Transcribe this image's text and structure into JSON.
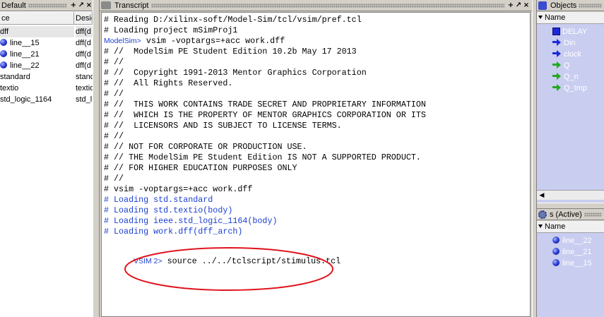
{
  "left_panel": {
    "title": "Default",
    "columns": [
      "ce",
      "Desig"
    ],
    "rows": [
      {
        "name": "dff",
        "design": "dff(d",
        "icon": "",
        "selected": true
      },
      {
        "name": "line__15",
        "design": "dff(d",
        "icon": "process-ball-icon",
        "selected": false
      },
      {
        "name": "line__21",
        "design": "dff(d",
        "icon": "process-ball-icon",
        "selected": false
      },
      {
        "name": "line__22",
        "design": "dff(d",
        "icon": "process-ball-icon",
        "selected": false
      },
      {
        "name": "standard",
        "design": "stand",
        "icon": "",
        "selected": false
      },
      {
        "name": "textio",
        "design": "textio",
        "icon": "",
        "selected": false
      },
      {
        "name": "std_logic_1164",
        "design": "std_l",
        "icon": "",
        "selected": false
      }
    ]
  },
  "transcript": {
    "title": "Transcript",
    "lines": [
      {
        "text": "# Reading D:/xilinx-soft/Model-Sim/tcl/vsim/pref.tcl",
        "style": "normal"
      },
      {
        "text": "# Loading project mSimProj1",
        "style": "normal"
      },
      {
        "prompt": "ModelSim>",
        "text": " vsim -voptargs=+acc work.dff",
        "style": "prompt"
      },
      {
        "text": "# //  ModelSim PE Student Edition 10.2b May 17 2013",
        "style": "normal"
      },
      {
        "text": "# //",
        "style": "normal"
      },
      {
        "text": "# //  Copyright 1991-2013 Mentor Graphics Corporation",
        "style": "normal"
      },
      {
        "text": "# //  All Rights Reserved.",
        "style": "normal"
      },
      {
        "text": "# //",
        "style": "normal"
      },
      {
        "text": "# //  THIS WORK CONTAINS TRADE SECRET AND PROPRIETARY INFORMATION",
        "style": "normal"
      },
      {
        "text": "# //  WHICH IS THE PROPERTY OF MENTOR GRAPHICS CORPORATION OR ITS",
        "style": "normal"
      },
      {
        "text": "# //  LICENSORS AND IS SUBJECT TO LICENSE TERMS.",
        "style": "normal"
      },
      {
        "text": "# //",
        "style": "normal"
      },
      {
        "text": "# // NOT FOR CORPORATE OR PRODUCTION USE.",
        "style": "normal"
      },
      {
        "text": "# // THE ModelSim PE Student Edition IS NOT A SUPPORTED PRODUCT.",
        "style": "normal"
      },
      {
        "text": "# // FOR HIGHER EDUCATION PURPOSES ONLY",
        "style": "normal"
      },
      {
        "text": "# //",
        "style": "normal"
      },
      {
        "text": "# vsim -voptargs=+acc work.dff",
        "style": "normal"
      },
      {
        "text": "# Loading std.standard",
        "style": "blue"
      },
      {
        "text": "# Loading std.textio(body)",
        "style": "blue"
      },
      {
        "text": "# Loading ieee.std_logic_1164(body)",
        "style": "blue"
      },
      {
        "text": "# Loading work.dff(dff_arch)",
        "style": "blue"
      }
    ],
    "command_prompt": "VSIM 2>",
    "command": " source ../../tclscript/stimulus.tcl",
    "annotation_color": "#e0141e"
  },
  "objects": {
    "title": "Objects",
    "column": "Name",
    "items": [
      {
        "name": "DELAY",
        "kind": "constant-icon"
      },
      {
        "name": "Din",
        "kind": "input-port-icon"
      },
      {
        "name": "clock",
        "kind": "input-port-icon"
      },
      {
        "name": "Q",
        "kind": "output-port-icon"
      },
      {
        "name": "Q_n",
        "kind": "output-port-icon"
      },
      {
        "name": "Q_tmp",
        "kind": "output-port-icon"
      }
    ]
  },
  "processes": {
    "title": "s (Active)",
    "column": "Name",
    "items": [
      {
        "name": "line__22"
      },
      {
        "name": "line__21"
      },
      {
        "name": "line__15"
      }
    ]
  },
  "colors": {
    "transcript_blue": "#1a3fd0",
    "panel_bg": "#c9cdf0",
    "frame": "#d4d0c8"
  }
}
